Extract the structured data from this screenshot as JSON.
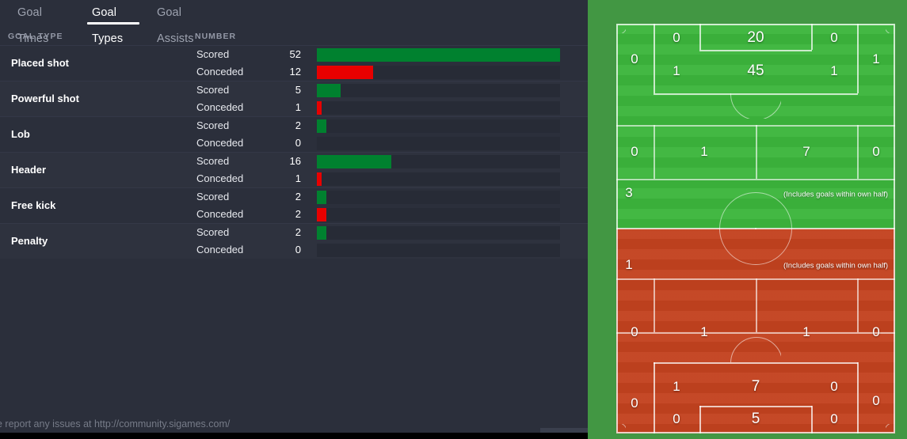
{
  "tabs": [
    {
      "label": "Goal Times",
      "active": false
    },
    {
      "label": "Goal Types",
      "active": true
    },
    {
      "label": "Goal Assists",
      "active": false
    }
  ],
  "table": {
    "headers": {
      "type": "GOAL TYPE",
      "number": "NUMBER"
    },
    "scored_label": "Scored",
    "conceded_label": "Conceded",
    "rows": [
      {
        "type": "Placed shot",
        "scored": 52,
        "conceded": 12
      },
      {
        "type": "Powerful shot",
        "scored": 5,
        "conceded": 1
      },
      {
        "type": "Lob",
        "scored": 2,
        "conceded": 0
      },
      {
        "type": "Header",
        "scored": 16,
        "conceded": 1
      },
      {
        "type": "Free kick",
        "scored": 2,
        "conceded": 2
      },
      {
        "type": "Penalty",
        "scored": 2,
        "conceded": 0
      }
    ],
    "max_value": 52
  },
  "chart_data": {
    "type": "bar",
    "title": "Goal Types",
    "categories": [
      "Placed shot",
      "Powerful shot",
      "Lob",
      "Header",
      "Free kick",
      "Penalty"
    ],
    "series": [
      {
        "name": "Scored",
        "values": [
          52,
          5,
          2,
          16,
          2,
          2
        ],
        "color": "#00812f"
      },
      {
        "name": "Conceded",
        "values": [
          12,
          1,
          0,
          1,
          2,
          0
        ],
        "color": "#e80000"
      }
    ],
    "xlabel": "",
    "ylabel": "",
    "xlim": [
      0,
      52
    ],
    "grid": false,
    "legend": "none"
  },
  "pitch": {
    "note": "(Includes goals within own half)",
    "scored_half": {
      "six_yard": [
        0,
        20,
        0
      ],
      "penalty_area": [
        1,
        45,
        1
      ],
      "wide_left": 0,
      "wide_right": 1,
      "band": [
        0,
        1,
        7,
        0
      ],
      "center_band": 3
    },
    "conceded_half": {
      "center_band": 1,
      "band": [
        0,
        1,
        1,
        0
      ],
      "penalty_area": [
        1,
        7,
        0
      ],
      "six_yard": [
        0,
        5,
        0
      ],
      "wide_left": 0,
      "wide_right": 0
    },
    "colors": {
      "scored": "#3cb53c",
      "conceded": "#c3421f",
      "surround": "#429743"
    }
  },
  "status": {
    "text": "e report any issues at http://community.sigames.com/"
  }
}
